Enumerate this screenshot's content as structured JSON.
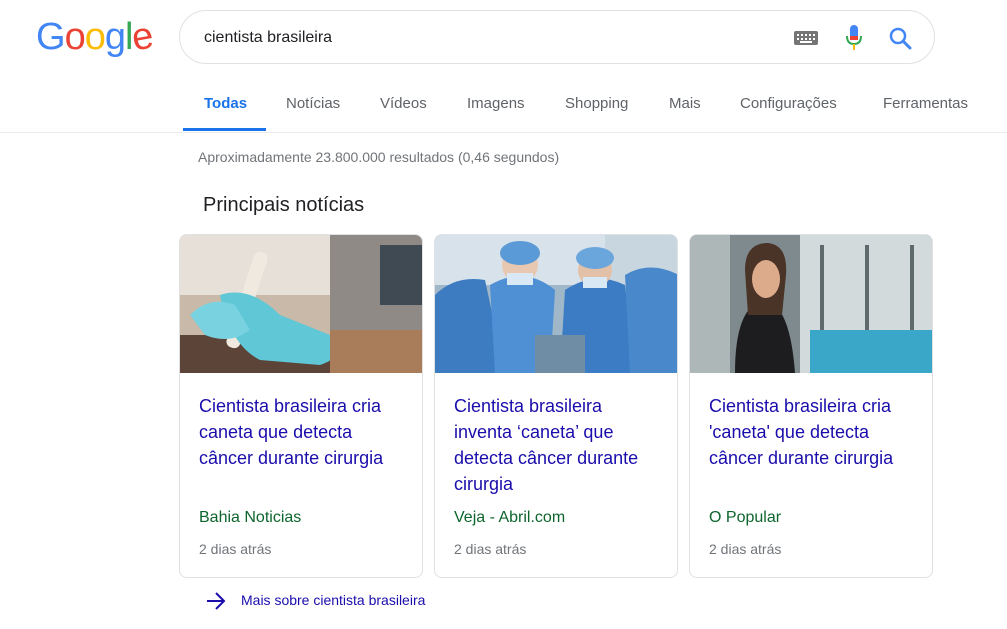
{
  "logo": [
    "G",
    "o",
    "o",
    "g",
    "l",
    "e"
  ],
  "search": {
    "query": "cientista brasileira"
  },
  "tabs": [
    {
      "label": "Todas"
    },
    {
      "label": "Notícias"
    },
    {
      "label": "Vídeos"
    },
    {
      "label": "Imagens"
    },
    {
      "label": "Shopping"
    },
    {
      "label": "Mais"
    },
    {
      "label": "Configurações"
    },
    {
      "label": "Ferramentas"
    }
  ],
  "results_stats": "Aproximadamente 23.800.000 resultados (0,46 segundos)",
  "news": {
    "heading": "Principais notícias",
    "cards": [
      {
        "title": "Cientista brasileira cria caneta que detecta câncer durante cirurgia",
        "source": "Bahia Noticias",
        "time": "2 dias atrás"
      },
      {
        "title": "Cientista brasileira inventa ‘caneta’ que detecta câncer durante cirurgia",
        "source": "Veja - Abril.com",
        "time": "2 dias atrás"
      },
      {
        "title": "Cientista brasileira cria 'caneta' que detecta câncer durante cirurgia",
        "source": "O Popular",
        "time": "2 dias atrás"
      }
    ],
    "more_label": "Mais sobre cientista brasileira"
  },
  "colors": {
    "accent": "#1a73e8",
    "link": "#1a0dab",
    "source": "#0d652d",
    "muted": "#70757a",
    "logo": [
      "#4285f4",
      "#ea4335",
      "#fbbc05",
      "#4285f4",
      "#34a853",
      "#ea4335"
    ]
  }
}
